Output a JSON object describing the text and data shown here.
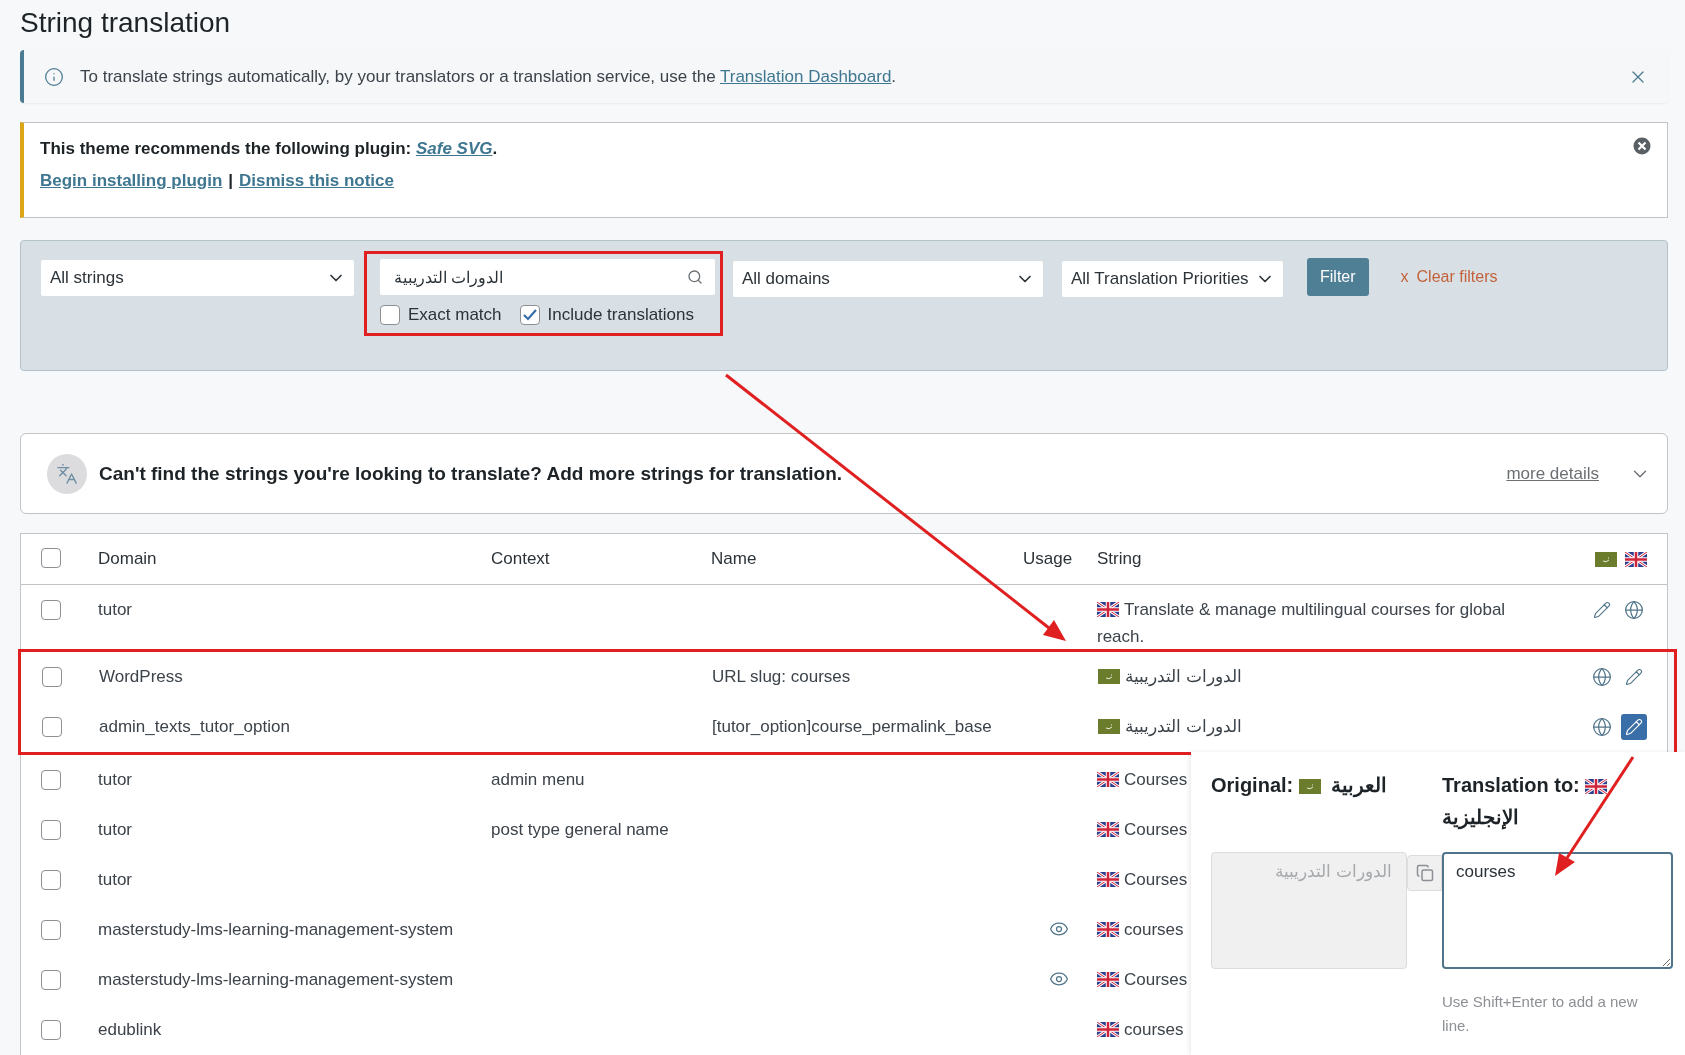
{
  "page_title": "String translation",
  "info_notice": {
    "text": "To translate strings automatically, by your translators or a translation service, use the ",
    "link": "Translation Dashboard",
    "suffix": "."
  },
  "plugin_notice": {
    "text": "This theme recommends the following plugin: ",
    "plugin_link": "Safe SVG",
    "suffix": ".",
    "actions": [
      "Begin installing plugin",
      "Dismiss this notice"
    ],
    "separator": "|"
  },
  "filters": {
    "string_type": "All strings",
    "search_value": "الدورات التدريبية",
    "exact_match": {
      "label": "Exact match",
      "checked": false
    },
    "include_translations": {
      "label": "Include translations",
      "checked": true
    },
    "domain": "All domains",
    "priority": "All Translation Priorities",
    "filter_button": "Filter",
    "clear_mark": "x",
    "clear_label": "Clear filters"
  },
  "add_strings": {
    "text": "Can't find the strings you're looking to translate? Add more strings for translation.",
    "link": "more details"
  },
  "table": {
    "select_all_checked": false,
    "columns": [
      "Domain",
      "Context",
      "Name",
      "Usage",
      "String"
    ],
    "header_flags": [
      {
        "kind": "ar"
      },
      {
        "kind": "en"
      }
    ],
    "rows": [
      {
        "checked": false,
        "highlighted": false,
        "domain": "tutor",
        "has_usage": false,
        "flag": {
          "kind": "en"
        },
        "string": "Translate & manage multilingual courses for global reach.",
        "actions": [
          {
            "kind": "edit",
            "active": false
          },
          {
            "kind": "globe",
            "active": false
          }
        ]
      },
      {
        "checked": false,
        "highlighted": true,
        "domain": "WordPress",
        "name": "URL slug: courses",
        "has_usage": false,
        "flag": {
          "kind": "ar"
        },
        "string": "الدورات التدريبية",
        "actions": [
          {
            "kind": "globe",
            "active": false
          },
          {
            "kind": "edit",
            "active": false
          }
        ]
      },
      {
        "checked": false,
        "highlighted": true,
        "domain": "admin_texts_tutor_option",
        "name": "[tutor_option]course_permalink_base",
        "has_usage": false,
        "flag": {
          "kind": "ar"
        },
        "string": "الدورات التدريبية",
        "actions": [
          {
            "kind": "globe",
            "active": false
          },
          {
            "kind": "edit",
            "active": true
          }
        ]
      },
      {
        "checked": false,
        "highlighted": false,
        "domain": "tutor",
        "context": "admin menu",
        "has_usage": false,
        "flag": {
          "kind": "en"
        },
        "string": "Courses"
      },
      {
        "checked": false,
        "highlighted": false,
        "domain": "tutor",
        "context": "post type general name",
        "has_usage": false,
        "flag": {
          "kind": "en"
        },
        "string": "Courses"
      },
      {
        "checked": false,
        "highlighted": false,
        "domain": "tutor",
        "has_usage": false,
        "flag": {
          "kind": "en"
        },
        "string": "Courses"
      },
      {
        "checked": false,
        "highlighted": false,
        "domain": "masterstudy-lms-learning-management-system",
        "has_usage": true,
        "flag": {
          "kind": "en"
        },
        "string": "courses"
      },
      {
        "checked": false,
        "highlighted": false,
        "domain": "masterstudy-lms-learning-management-system",
        "has_usage": true,
        "flag": {
          "kind": "en"
        },
        "string": "Courses"
      },
      {
        "checked": false,
        "highlighted": false,
        "domain": "edublink",
        "has_usage": false,
        "flag": {
          "kind": "en"
        },
        "string": "courses"
      }
    ]
  },
  "editor": {
    "original_label": "Original:",
    "original_flag": {
      "kind": "ar"
    },
    "original_language": "العربية",
    "translation_label": "Translation to:",
    "translation_flag": {
      "kind": "en"
    },
    "translation_language": "الإنجليزية",
    "original_text": "الدورات التدريبية",
    "translation_value": "courses",
    "hint": "Use Shift+Enter to add a new line."
  }
}
